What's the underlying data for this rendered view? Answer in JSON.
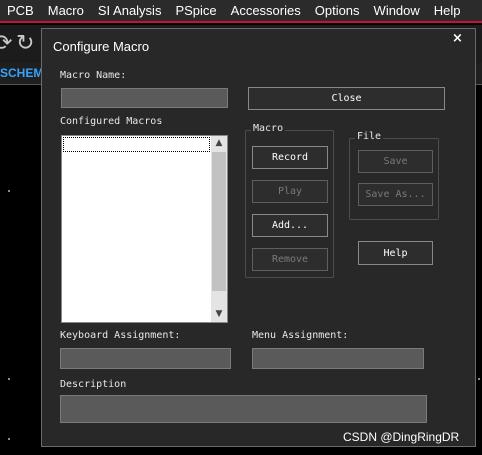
{
  "menubar": {
    "items": [
      "PCB",
      "Macro",
      "SI Analysis",
      "PSpice",
      "Accessories",
      "Options",
      "Window",
      "Help"
    ]
  },
  "toolbar": {
    "icons": [
      "refresh-icon",
      "refresh-icon",
      "find-icon"
    ]
  },
  "tabstrip": {
    "active_tab_label": "SCHEM"
  },
  "dialog": {
    "title": "Configure Macro",
    "close_glyph": "×",
    "macro_name_label": "Macro Name:",
    "macro_name_value": "",
    "close_button": "Close",
    "configured_macros_label": "Configured Macros",
    "configured_macros_items": [],
    "macro_group": {
      "title": "Macro",
      "record": "Record",
      "play": "Play",
      "add": "Add...",
      "remove": "Remove"
    },
    "file_group": {
      "title": "File",
      "save": "Save",
      "save_as": "Save As..."
    },
    "help_button": "Help",
    "keyboard_assignment_label": "Keyboard Assignment:",
    "keyboard_assignment_value": "",
    "menu_assignment_label": "Menu Assignment:",
    "menu_assignment_value": "",
    "description_label": "Description",
    "description_value": ""
  },
  "watermark": "CSDN @DingRingDR",
  "colors": {
    "menubar_accent": "#c8103a",
    "dialog_bg": "#282828",
    "field_bg": "#5a5a5a",
    "tab_text": "#36a3ff"
  }
}
